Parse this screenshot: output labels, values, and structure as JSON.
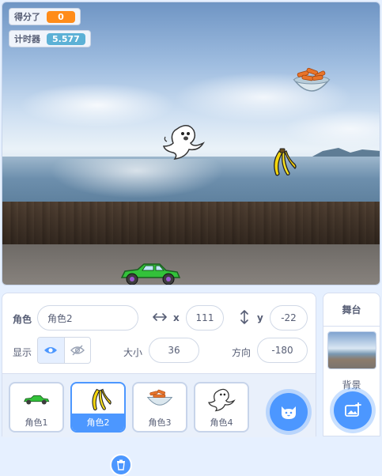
{
  "monitors": {
    "score": {
      "label": "得分了",
      "value": "0",
      "color": "#ff8c1a"
    },
    "timer": {
      "label": "计时器",
      "value": "5.577",
      "color": "#5cb1d6"
    }
  },
  "stage_sprites": [
    "food-bowl",
    "ghost",
    "banana",
    "car"
  ],
  "sprite_info": {
    "sprite_label": "角色",
    "sprite_name": "角色2",
    "x_label": "x",
    "x_value": "111",
    "y_label": "y",
    "y_value": "-22",
    "show_label": "显示",
    "size_label": "大小",
    "size_value": "36",
    "direction_label": "方向",
    "direction_value": "-180"
  },
  "sprites": [
    {
      "name": "角色1",
      "icon": "car",
      "selected": false
    },
    {
      "name": "角色2",
      "icon": "banana",
      "selected": true
    },
    {
      "name": "角色3",
      "icon": "food-bowl",
      "selected": false
    },
    {
      "name": "角色4",
      "icon": "ghost",
      "selected": false
    }
  ],
  "stage_panel": {
    "title": "舞台",
    "backdrop_label": "背景"
  },
  "colors": {
    "accent": "#4c97ff"
  }
}
